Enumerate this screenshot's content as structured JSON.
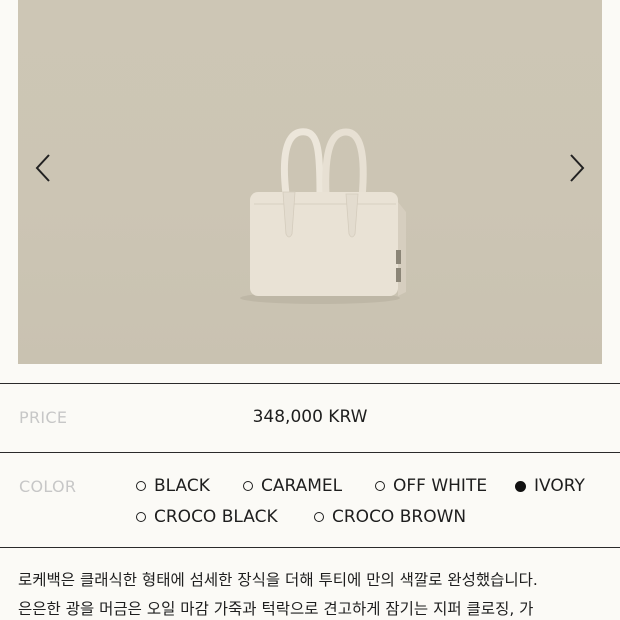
{
  "gallery": {
    "prev_icon": "chevron-left-icon",
    "next_icon": "chevron-right-icon",
    "background_color": "#ccc5b4",
    "product_color": "#e8e1d3"
  },
  "price": {
    "label": "PRICE",
    "value": "348,000 KRW"
  },
  "color": {
    "label": "COLOR",
    "options": [
      {
        "label": "BLACK",
        "selected": false
      },
      {
        "label": "CARAMEL",
        "selected": false
      },
      {
        "label": "OFF WHITE",
        "selected": false
      },
      {
        "label": "IVORY",
        "selected": true
      },
      {
        "label": "CROCO BLACK",
        "selected": false
      },
      {
        "label": "CROCO BROWN",
        "selected": false
      }
    ]
  },
  "description": {
    "line1": "로케백은 클래식한 형태에 섬세한 장식을 더해 투티에 만의 색깔로 완성했습니다.",
    "line2": "은은한 광을 머금은 오일 마감 가죽과 턱락으로 견고하게 잠기는 지퍼 클로징, 가"
  }
}
